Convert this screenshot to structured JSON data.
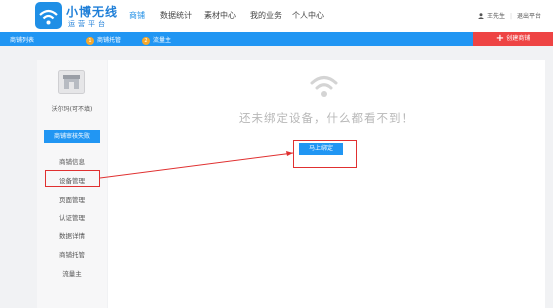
{
  "header": {
    "brand_name": "小博无线",
    "brand_sub": "运营平台",
    "nav": [
      {
        "label": "商铺"
      },
      {
        "label": "数据统计"
      },
      {
        "label": "素材中心"
      },
      {
        "label": "我的业务"
      },
      {
        "label": "个人中心"
      }
    ],
    "user_name": "王先生",
    "logout": "退出平台"
  },
  "subbar": {
    "items": [
      {
        "label": "商铺列表"
      },
      {
        "badge": "1",
        "label": "商铺托管"
      },
      {
        "badge": "2",
        "label": "流量主"
      }
    ],
    "create_button": "创建商铺"
  },
  "sidebar": {
    "store_name": "沃尔玛(可不填)",
    "status_button": "商铺审核失败",
    "menu": [
      {
        "label": "商铺信息"
      },
      {
        "label": "设备管理"
      },
      {
        "label": "页面管理"
      },
      {
        "label": "认证管理"
      },
      {
        "label": "数据详情"
      },
      {
        "label": "商铺托管"
      },
      {
        "label": "流量主"
      }
    ]
  },
  "main": {
    "empty_message": "还未绑定设备，什么都看不到！",
    "bind_button": "马上绑定"
  },
  "colors": {
    "primary": "#2196f3",
    "create": "#ee4444",
    "badge": "#f6a82b",
    "annotation": "#e03030"
  },
  "icons": [
    "logo-icon",
    "user-icon",
    "store-icon",
    "wifi-icon",
    "plus-icon"
  ]
}
